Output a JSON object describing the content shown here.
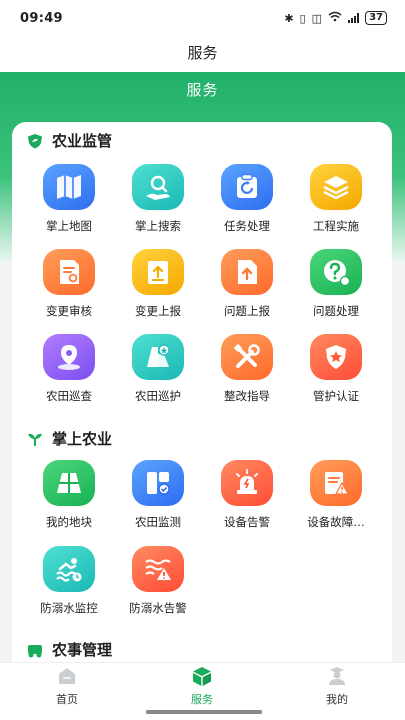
{
  "status_bar": {
    "time": "09:49",
    "battery": "37"
  },
  "header": {
    "title": "服务"
  },
  "banner": {
    "title": "服务"
  },
  "sections": {
    "s1": {
      "title": "农业监管",
      "items": [
        {
          "label": "掌上地图",
          "icon": "map-icon",
          "color": "blue"
        },
        {
          "label": "掌上搜索",
          "icon": "search-hand-icon",
          "color": "teal"
        },
        {
          "label": "任务处理",
          "icon": "task-icon",
          "color": "blue"
        },
        {
          "label": "工程实施",
          "icon": "layers-icon",
          "color": "yellow"
        },
        {
          "label": "变更审核",
          "icon": "review-doc-icon",
          "color": "orange"
        },
        {
          "label": "变更上报",
          "icon": "upload-doc-icon",
          "color": "yellow"
        },
        {
          "label": "问题上报",
          "icon": "upload-file-icon",
          "color": "orange"
        },
        {
          "label": "问题处理",
          "icon": "question-icon",
          "color": "green"
        },
        {
          "label": "农田巡查",
          "icon": "location-pin-icon",
          "color": "purple"
        },
        {
          "label": "农田巡护",
          "icon": "field-star-icon",
          "color": "teal"
        },
        {
          "label": "整改指导",
          "icon": "tools-icon",
          "color": "orange"
        },
        {
          "label": "管护认证",
          "icon": "shield-star-icon",
          "color": "red"
        }
      ]
    },
    "s2": {
      "title": "掌上农业",
      "items": [
        {
          "label": "我的地块",
          "icon": "grid-plot-icon",
          "color": "green"
        },
        {
          "label": "农田监测",
          "icon": "monitor-icon",
          "color": "blue"
        },
        {
          "label": "设备告警",
          "icon": "alarm-light-icon",
          "color": "red"
        },
        {
          "label": "设备故障…",
          "icon": "fault-doc-icon",
          "color": "orange"
        },
        {
          "label": "防溺水监控",
          "icon": "swimmer-icon",
          "color": "teal"
        },
        {
          "label": "防溺水告警",
          "icon": "water-warning-icon",
          "color": "red"
        }
      ]
    },
    "s3": {
      "title": "农事管理"
    }
  },
  "tabbar": {
    "home": "首页",
    "service": "服务",
    "mine": "我的"
  },
  "colors": {
    "accent": "#1aaa5c",
    "banner": "#21b06a"
  }
}
